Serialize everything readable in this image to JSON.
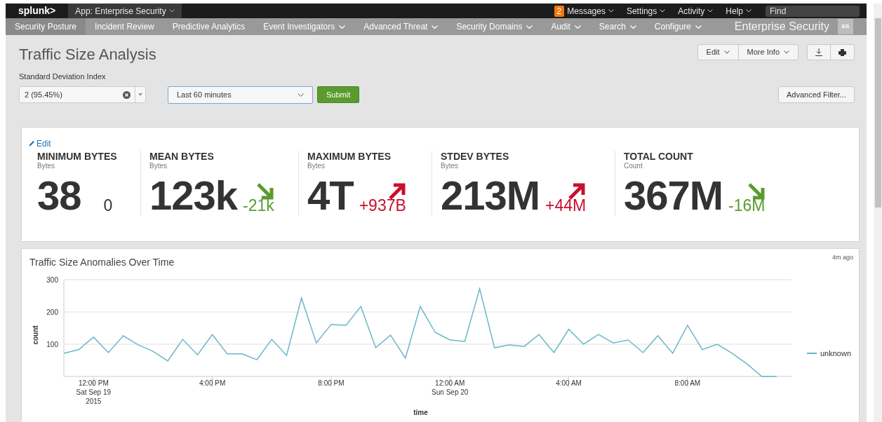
{
  "top_bar": {
    "logo": "splunk>",
    "app_menu": "App: Enterprise Security",
    "messages": {
      "badge": "2",
      "label": "Messages"
    },
    "menus": [
      "Settings",
      "Activity",
      "Help"
    ],
    "find": {
      "placeholder": "Find"
    }
  },
  "nav": {
    "items": [
      {
        "label": "Security Posture",
        "selected": true,
        "dropdown": false
      },
      {
        "label": "Incident Review",
        "selected": false,
        "dropdown": false
      },
      {
        "label": "Predictive Analytics",
        "selected": false,
        "dropdown": false
      },
      {
        "label": "Event Investigators",
        "selected": false,
        "dropdown": true
      },
      {
        "label": "Advanced Threat",
        "selected": false,
        "dropdown": true
      },
      {
        "label": "Security Domains",
        "selected": false,
        "dropdown": true
      },
      {
        "label": "Audit",
        "selected": false,
        "dropdown": true
      },
      {
        "label": "Search",
        "selected": false,
        "dropdown": true
      },
      {
        "label": "Configure",
        "selected": false,
        "dropdown": true
      }
    ],
    "app_title": "Enterprise Security",
    "app_badge": "ES"
  },
  "page": {
    "title": "Traffic Size Analysis",
    "edit_button": "Edit",
    "more_info_button": "More Info",
    "advanced_filter_button": "Advanced Filter...",
    "std_dev": {
      "label": "Standard Deviation Index",
      "value": "2 (95.45%)"
    },
    "time_range": {
      "value": "Last 60 minutes"
    },
    "submit_button": "Submit"
  },
  "metrics_panel": {
    "edit_link": "Edit",
    "metrics": [
      {
        "kind": "flat",
        "label": "MINIMUM BYTES",
        "unit": "Bytes",
        "value": "38",
        "delta": "0"
      },
      {
        "kind": "down",
        "label": "MEAN BYTES",
        "unit": "Bytes",
        "value": "123k",
        "delta": "-21k"
      },
      {
        "kind": "up",
        "label": "MAXIMUM BYTES",
        "unit": "Bytes",
        "value": "4T",
        "delta": "+937B"
      },
      {
        "kind": "up",
        "label": "STDEV BYTES",
        "unit": "Bytes",
        "value": "213M",
        "delta": "+44M"
      },
      {
        "kind": "down",
        "label": "TOTAL COUNT",
        "unit": "Count",
        "value": "367M",
        "delta": "-16M"
      }
    ]
  },
  "chart_panel": {
    "title": "Traffic Size Anomalies Over Time",
    "age": "4m ago",
    "chart_data": {
      "type": "line",
      "xlabel": "time",
      "ylabel": "count",
      "x": [
        "2015-09-19T11:00",
        "2015-09-19T11:30",
        "2015-09-19T12:00",
        "2015-09-19T12:30",
        "2015-09-19T13:00",
        "2015-09-19T13:30",
        "2015-09-19T14:00",
        "2015-09-19T14:30",
        "2015-09-19T15:00",
        "2015-09-19T15:30",
        "2015-09-19T16:00",
        "2015-09-19T16:30",
        "2015-09-19T17:00",
        "2015-09-19T17:30",
        "2015-09-19T18:00",
        "2015-09-19T18:30",
        "2015-09-19T19:00",
        "2015-09-19T19:30",
        "2015-09-19T20:00",
        "2015-09-19T20:30",
        "2015-09-19T21:00",
        "2015-09-19T21:30",
        "2015-09-19T22:00",
        "2015-09-19T22:30",
        "2015-09-19T23:00",
        "2015-09-19T23:30",
        "2015-09-20T00:00",
        "2015-09-20T00:30",
        "2015-09-20T01:00",
        "2015-09-20T01:30",
        "2015-09-20T02:00",
        "2015-09-20T02:30",
        "2015-09-20T03:00",
        "2015-09-20T03:30",
        "2015-09-20T04:00",
        "2015-09-20T04:30",
        "2015-09-20T05:00",
        "2015-09-20T05:30",
        "2015-09-20T06:00",
        "2015-09-20T06:30",
        "2015-09-20T07:00",
        "2015-09-20T07:30",
        "2015-09-20T08:00",
        "2015-09-20T08:30",
        "2015-09-20T09:00",
        "2015-09-20T09:30",
        "2015-09-20T10:00",
        "2015-09-20T10:30",
        "2015-09-20T11:00"
      ],
      "series": [
        {
          "name": "unknown",
          "color": "#6ab7c7",
          "values": [
            72,
            83,
            122,
            74,
            126,
            98,
            78,
            48,
            115,
            67,
            130,
            70,
            70,
            52,
            115,
            65,
            243,
            104,
            161,
            159,
            217,
            89,
            128,
            57,
            217,
            137,
            113,
            109,
            272,
            89,
            98,
            93,
            130,
            74,
            146,
            100,
            130,
            104,
            113,
            74,
            126,
            72,
            159,
            83,
            100,
            72,
            39,
            0,
            0
          ]
        }
      ],
      "xlim": [
        "2015-09-19T11:00",
        "2015-09-20T11:30"
      ],
      "ylim": [
        0,
        300
      ],
      "yticks": [
        {
          "value": 100,
          "label": "100"
        },
        {
          "value": 200,
          "label": "200"
        },
        {
          "value": 300,
          "label": "300"
        }
      ],
      "xticks": [
        {
          "value": "2015-09-19T12:00",
          "label": "12:00 PM\nSat Sep 19\n2015"
        },
        {
          "value": "2015-09-19T16:00",
          "label": "4:00 PM"
        },
        {
          "value": "2015-09-19T20:00",
          "label": "8:00 PM"
        },
        {
          "value": "2015-09-20T00:00",
          "label": "12:00 AM\nSun Sep 20"
        },
        {
          "value": "2015-09-20T04:00",
          "label": "4:00 AM"
        },
        {
          "value": "2015-09-20T08:00",
          "label": "8:00 AM"
        }
      ]
    }
  }
}
